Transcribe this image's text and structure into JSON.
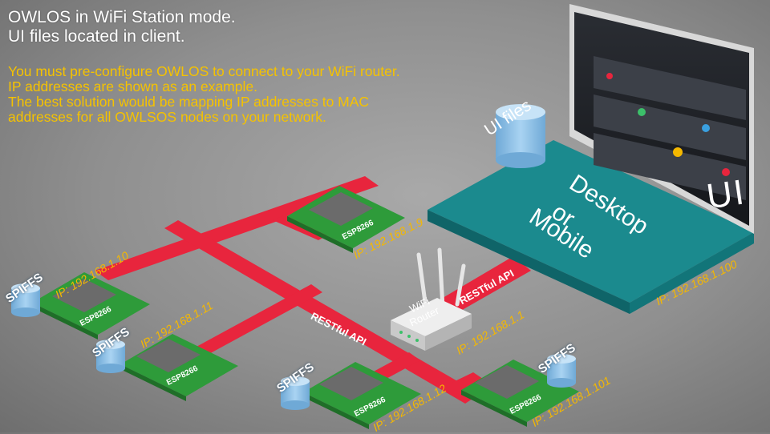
{
  "headline": {
    "line1": "OWLOS in WiFi Station mode.",
    "line2": "UI files located in client."
  },
  "note": {
    "line1": "You must pre-configure OWLOS to connect to your WiFi router.",
    "line2": "IP addresses are shown as an example.",
    "line3": "The best solution would be mapping IP addresses to MAC",
    "line4": "addresses for all OWLSOS nodes on your network."
  },
  "client": {
    "title_line1": "Desktop",
    "title_line2": "or",
    "title_line3": "Mobile",
    "ui_label": "UI",
    "storage_label": "UI files",
    "ip": "IP: 192.168.1.100"
  },
  "router": {
    "label_line1": "WiFi",
    "label_line2": "Router",
    "ip": "IP: 192.168.1.1"
  },
  "links": {
    "api_left": "RESTful API",
    "api_right": "RESTful API"
  },
  "nodes": [
    {
      "chip": "ESP8266",
      "ip": "IP: 192.168.1.9"
    },
    {
      "chip": "ESP8266",
      "ip": "IP: 192.168.1.10",
      "storage": "SPIFFS"
    },
    {
      "chip": "ESP8266",
      "ip": "IP: 192.168.1.11",
      "storage": "SPIFFS"
    },
    {
      "chip": "ESP8266",
      "ip": "IP: 192.168.1.12",
      "storage": "SPIFFS"
    },
    {
      "chip": "ESP8266",
      "ip": "IP: 192.168.1.101",
      "storage": "SPIFFS"
    }
  ],
  "colors": {
    "network": "#e8253d",
    "board": "#2e9b3a",
    "module": "#6b6b6b",
    "platform": "#1b8a8e",
    "storage": "#8fc3ea",
    "ip_text": "#f5b800",
    "note_text": "#f5c200",
    "headline_text": "#ffffff"
  }
}
